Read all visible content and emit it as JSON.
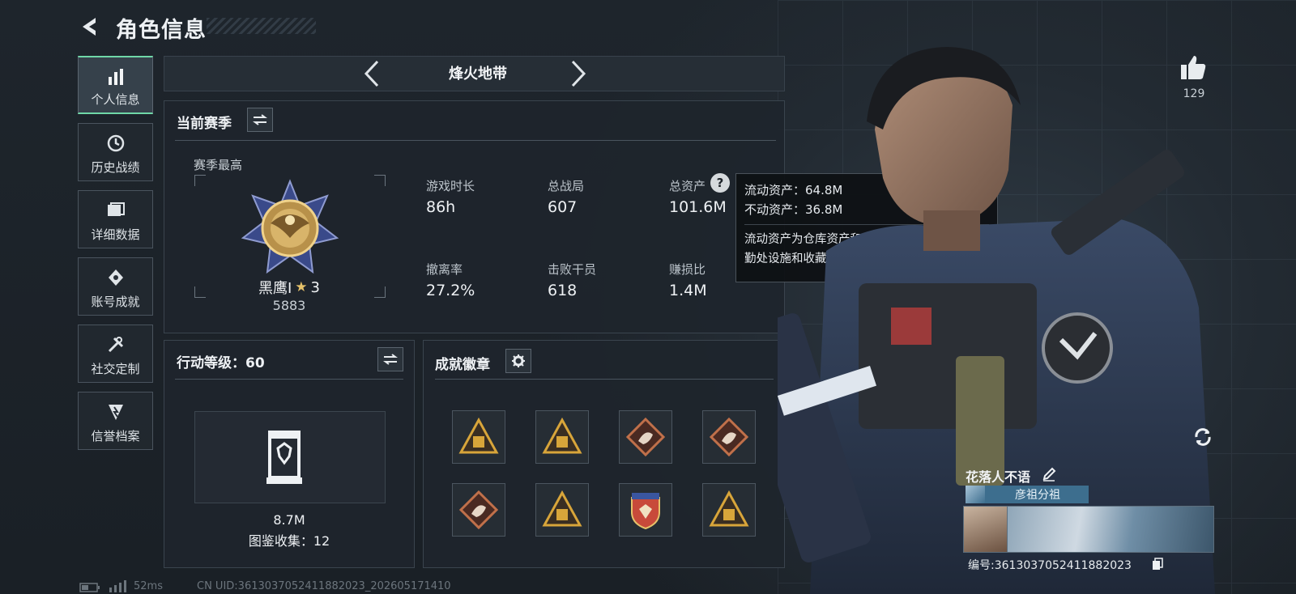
{
  "header": {
    "title": "角色信息"
  },
  "sidebar": {
    "items": [
      {
        "label": "个人信息",
        "icon": "bar-chart-icon",
        "active": true
      },
      {
        "label": "历史战绩",
        "icon": "history-icon",
        "active": false
      },
      {
        "label": "详细数据",
        "icon": "folder-icon",
        "active": false
      },
      {
        "label": "账号成就",
        "icon": "achievement-icon",
        "active": false
      },
      {
        "label": "社交定制",
        "icon": "tools-icon",
        "active": false
      },
      {
        "label": "信誉档案",
        "icon": "credit-icon",
        "active": false
      }
    ]
  },
  "mode": {
    "name": "烽火地带"
  },
  "season": {
    "title": "当前赛季",
    "best_label": "赛季最高",
    "rank_name": "黑鹰Ⅰ",
    "rank_stars": "3",
    "rank_score": "5883",
    "stats": [
      {
        "label": "游戏时长",
        "value": "86h"
      },
      {
        "label": "总战局",
        "value": "607"
      },
      {
        "label": "总资产",
        "value": "101.6M"
      },
      {
        "label": "撤离率",
        "value": "27.2%"
      },
      {
        "label": "击败干员",
        "value": "618"
      },
      {
        "label": "赚损比",
        "value": "1.4M"
      }
    ]
  },
  "tooltip": {
    "liquid": "流动资产：64.8M",
    "fixed": "不动资产：36.8M",
    "description": "流动资产为仓库资产和哈夫币，不动资产为特勤处设施和收藏室设施"
  },
  "action_level": {
    "title": "行动等级：60",
    "value": "8.7M",
    "collection": "图鉴收集：12"
  },
  "badges": {
    "title": "成就徽章",
    "items": [
      {
        "icon": "triangle-badge-icon",
        "color": "#d8a53a"
      },
      {
        "icon": "triangle-badge-icon",
        "color": "#d8a53a"
      },
      {
        "icon": "diamond-badge-icon",
        "color": "#c0704a"
      },
      {
        "icon": "diamond-badge-icon",
        "color": "#c0704a"
      },
      {
        "icon": "diamond-badge-icon",
        "color": "#c0704a"
      },
      {
        "icon": "triangle-badge-icon",
        "color": "#d8a53a"
      },
      {
        "icon": "shield-badge-icon",
        "color": "#c84a3a"
      },
      {
        "icon": "triangle-badge-icon",
        "color": "#d8a53a"
      }
    ]
  },
  "likes": {
    "count": "129"
  },
  "player": {
    "name": "花落人不语",
    "title": "彦祖分祖",
    "id": "编号:3613037052411882023"
  },
  "status": {
    "ping": "52ms",
    "uid": "CN UID:3613037052411882023_202605171410"
  },
  "colors": {
    "accent": "#6fd8a8",
    "gold": "#d8a53a",
    "panel": "#1e252c"
  }
}
